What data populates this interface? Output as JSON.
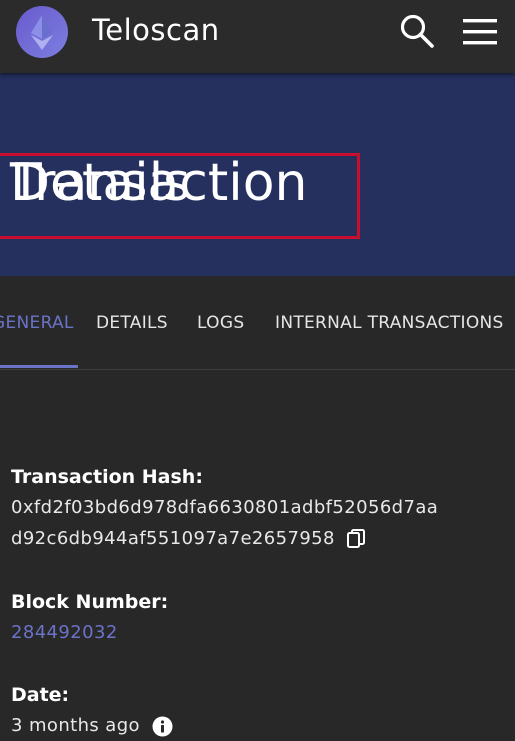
{
  "header": {
    "brand": "Teloscan",
    "logo_icon": "ethereum-logo-icon",
    "search_icon": "search-icon",
    "menu_icon": "hamburger-menu-icon"
  },
  "banner": {
    "title_overlap_a": "Transaction",
    "title_overlap_b": "Details"
  },
  "tabs": [
    {
      "label": "GENERAL",
      "active": true
    },
    {
      "label": "DETAILS",
      "active": false
    },
    {
      "label": "LOGS",
      "active": false
    },
    {
      "label": "INTERNAL TRANSACTIONS",
      "active": false
    }
  ],
  "fields": {
    "tx_hash_label": "Transaction Hash:",
    "tx_hash_line1": "0xfd2f03bd6d978dfa6630801adbf52056d7aa",
    "tx_hash_line2": "d92c6db944af551097a7e2657958",
    "block_label": "Block Number:",
    "block_value": "284492032",
    "date_label": "Date:",
    "date_value": "3 months ago"
  },
  "colors": {
    "accent": "#6b73c9",
    "banner": "#25305e",
    "highlight_border": "#c8102e",
    "background": "#282828"
  }
}
